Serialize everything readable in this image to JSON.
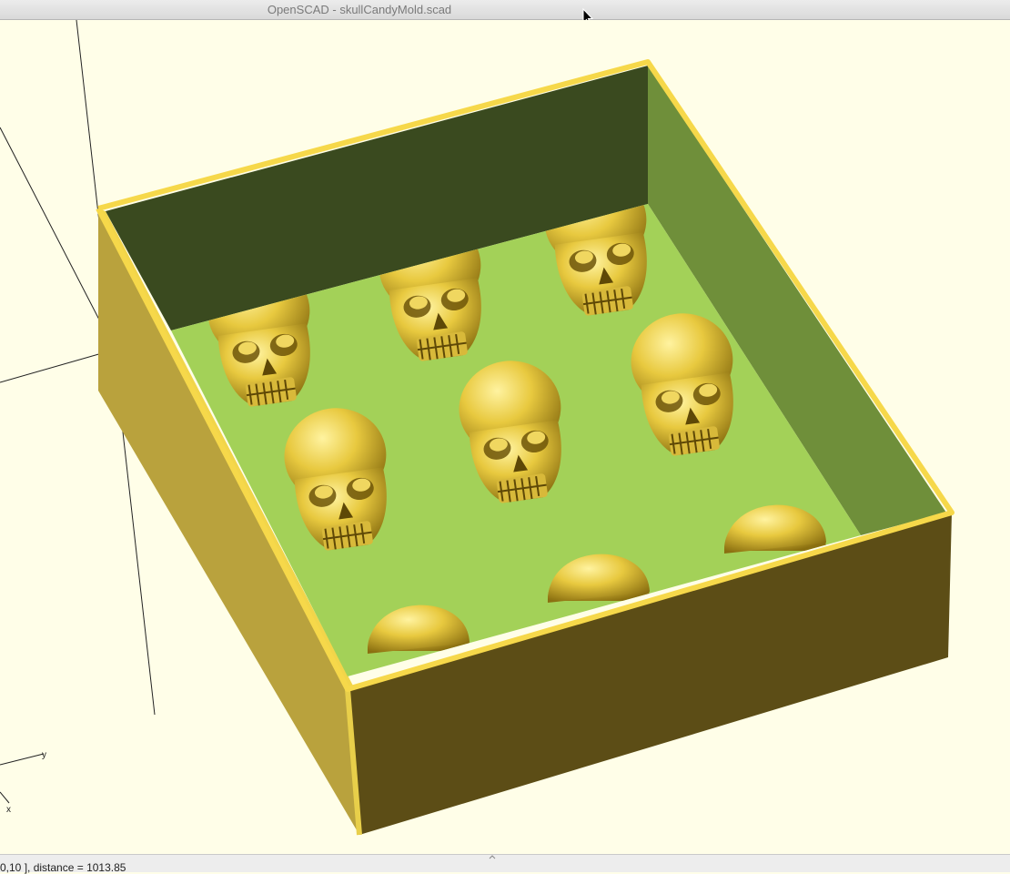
{
  "window": {
    "title": "OpenSCAD - skullCandyMold.scad"
  },
  "viewport": {
    "model": "skull candy mold",
    "axis_labels": {
      "y": "y",
      "x": "x"
    },
    "colors": {
      "background": "#fffee8",
      "face_yellow": "#f2d54a",
      "wall_outer_front": "#5c4d16",
      "wall_outer_left": "#b9a23d",
      "wall_inner_back": "#3a4a1f",
      "wall_inner_right": "#6f8f3a",
      "floor": "#a3d158",
      "skull": "#e6c840"
    }
  },
  "statusbar": {
    "text": "0,10 ], distance = 1013.85"
  }
}
